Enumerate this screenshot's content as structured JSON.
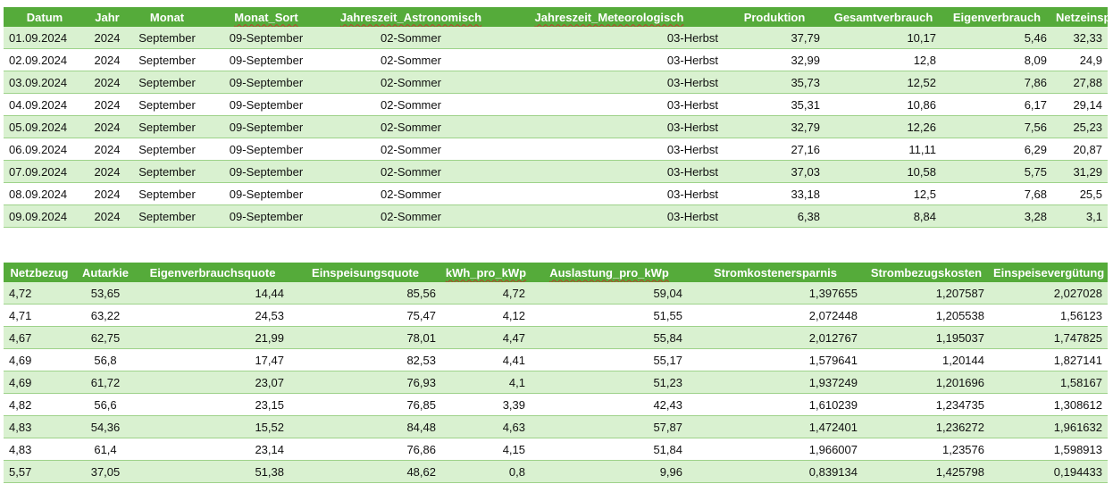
{
  "table1": {
    "headers": [
      "Datum",
      "Jahr",
      "Monat",
      "Monat_Sort",
      "Jahreszeit_Astronomisch",
      "Jahreszeit_Meteorologisch",
      "Produktion",
      "Gesamtverbrauch",
      "Eigenverbrauch",
      "Netzeinspeisung"
    ],
    "rows": [
      [
        "01.09.2024",
        "2024",
        "September",
        "09-September",
        "02-Sommer",
        "03-Herbst",
        "37,79",
        "10,17",
        "5,46",
        "32,33"
      ],
      [
        "02.09.2024",
        "2024",
        "September",
        "09-September",
        "02-Sommer",
        "03-Herbst",
        "32,99",
        "12,8",
        "8,09",
        "24,9"
      ],
      [
        "03.09.2024",
        "2024",
        "September",
        "09-September",
        "02-Sommer",
        "03-Herbst",
        "35,73",
        "12,52",
        "7,86",
        "27,88"
      ],
      [
        "04.09.2024",
        "2024",
        "September",
        "09-September",
        "02-Sommer",
        "03-Herbst",
        "35,31",
        "10,86",
        "6,17",
        "29,14"
      ],
      [
        "05.09.2024",
        "2024",
        "September",
        "09-September",
        "02-Sommer",
        "03-Herbst",
        "32,79",
        "12,26",
        "7,56",
        "25,23"
      ],
      [
        "06.09.2024",
        "2024",
        "September",
        "09-September",
        "02-Sommer",
        "03-Herbst",
        "27,16",
        "11,11",
        "6,29",
        "20,87"
      ],
      [
        "07.09.2024",
        "2024",
        "September",
        "09-September",
        "02-Sommer",
        "03-Herbst",
        "37,03",
        "10,58",
        "5,75",
        "31,29"
      ],
      [
        "08.09.2024",
        "2024",
        "September",
        "09-September",
        "02-Sommer",
        "03-Herbst",
        "33,18",
        "12,5",
        "7,68",
        "25,5"
      ],
      [
        "09.09.2024",
        "2024",
        "September",
        "09-September",
        "02-Sommer",
        "03-Herbst",
        "6,38",
        "8,84",
        "3,28",
        "3,1"
      ]
    ]
  },
  "table2": {
    "headers": [
      "Netzbezug",
      "Autarkie",
      "Eigenverbrauchsquote",
      "Einspeisungsquote",
      "kWh_pro_kWp",
      "Auslastung_pro_kWp",
      "Stromkostenersparnis",
      "Strombezugskosten",
      "Einspeisevergütung"
    ],
    "rows": [
      [
        "4,72",
        "53,65",
        "14,44",
        "85,56",
        "4,72",
        "59,04",
        "1,397655",
        "1,207587",
        "2,027028"
      ],
      [
        "4,71",
        "63,22",
        "24,53",
        "75,47",
        "4,12",
        "51,55",
        "2,072448",
        "1,205538",
        "1,56123"
      ],
      [
        "4,67",
        "62,75",
        "21,99",
        "78,01",
        "4,47",
        "55,84",
        "2,012767",
        "1,195037",
        "1,747825"
      ],
      [
        "4,69",
        "56,8",
        "17,47",
        "82,53",
        "4,41",
        "55,17",
        "1,579641",
        "1,20144",
        "1,827141"
      ],
      [
        "4,69",
        "61,72",
        "23,07",
        "76,93",
        "4,1",
        "51,23",
        "1,937249",
        "1,201696",
        "1,58167"
      ],
      [
        "4,82",
        "56,6",
        "23,15",
        "76,85",
        "3,39",
        "42,43",
        "1,610239",
        "1,234735",
        "1,308612"
      ],
      [
        "4,83",
        "54,36",
        "15,52",
        "84,48",
        "4,63",
        "57,87",
        "1,472401",
        "1,236272",
        "1,961632"
      ],
      [
        "4,83",
        "61,4",
        "23,14",
        "76,86",
        "4,15",
        "51,84",
        "1,966007",
        "1,23576",
        "1,598913"
      ],
      [
        "5,57",
        "37,05",
        "51,38",
        "48,62",
        "0,8",
        "9,96",
        "0,839134",
        "1,425798",
        "0,194433"
      ]
    ]
  },
  "colors": {
    "header_bg": "#55ab3a",
    "band_green": "#d9f1d0",
    "band_white": "#ffffff",
    "row_border": "#9ed28a"
  }
}
